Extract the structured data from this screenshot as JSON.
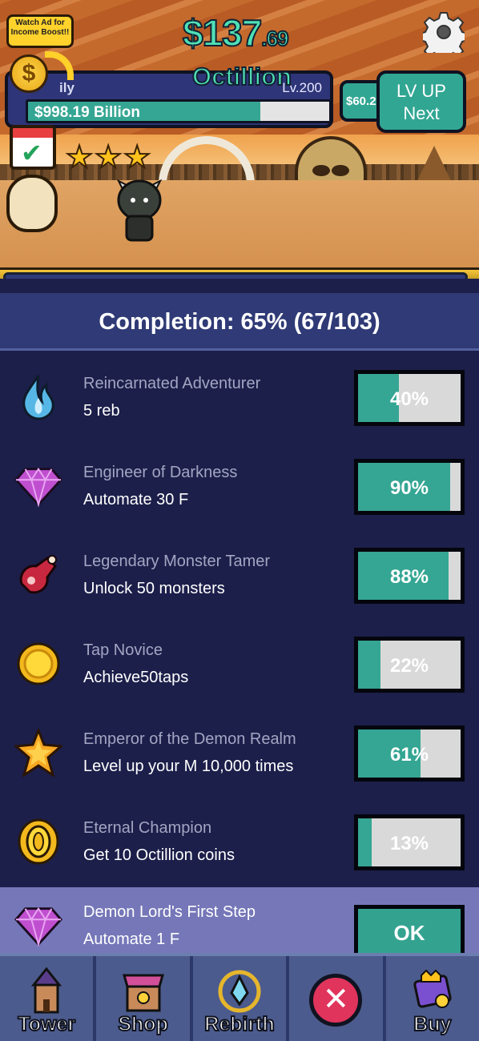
{
  "scene": {
    "ad_label": "Watch Ad for Income Boost!!",
    "money_main": "$137",
    "money_cents": ".69",
    "money_unit": "Octillion",
    "facility_name": "ily",
    "level": "Lv.200",
    "income": "$998.19 Billion",
    "income_progress": 0.77,
    "next_cost": "$60.2",
    "lvup_line1": "LV UP",
    "lvup_line2": "Next",
    "stars": 3
  },
  "completion": {
    "text": "Completion: 65% (67/103)"
  },
  "achievements": [
    {
      "title": "Reincarnated Adventurer",
      "desc": "5 reb",
      "progress": 0.4,
      "pct": "40%",
      "icon": "blue-flame-icon"
    },
    {
      "title": "Engineer of Darkness",
      "desc": "Automate 30 F",
      "progress": 0.9,
      "pct": "90%",
      "icon": "purple-gem-icon"
    },
    {
      "title": "Legendary Monster Tamer",
      "desc": "Unlock 50 monsters",
      "progress": 0.88,
      "pct": "88%",
      "icon": "meat-icon"
    },
    {
      "title": "Tap Novice",
      "desc": "Achieve50taps",
      "progress": 0.22,
      "pct": "22%",
      "icon": "gold-coin-icon"
    },
    {
      "title": "Emperor of the Demon Realm",
      "desc": "Level up your M 10,000 times",
      "progress": 0.61,
      "pct": "61%",
      "icon": "star-icon"
    },
    {
      "title": "Eternal Champion",
      "desc": "Get 10 Octillion coins",
      "progress": 0.13,
      "pct": "13%",
      "icon": "coin-stack-icon"
    }
  ],
  "claimable": {
    "title": "Demon Lord's First Step",
    "desc": "Automate 1 F",
    "button": "OK"
  },
  "nav": {
    "tower": "Tower",
    "shop": "Shop",
    "rebirth": "Rebirth",
    "buy": "Buy"
  }
}
